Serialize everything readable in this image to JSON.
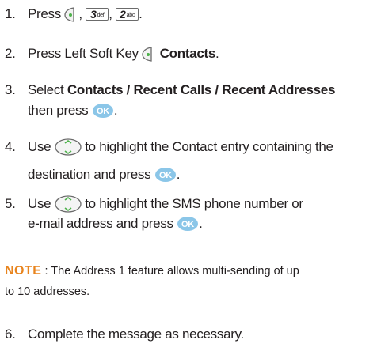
{
  "steps": [
    {
      "num": "1.",
      "press": "Press",
      "key3_digit": "3",
      "key3_letters": "def",
      "key2_digit": "2",
      "key2_letters": "abc"
    },
    {
      "num": "2.",
      "text": "Press Left Soft Key",
      "bold": "Contacts"
    },
    {
      "num": "3.",
      "pre": "Select",
      "bold": "Contacts / Recent Calls / Recent Addresses",
      "line2": "then press"
    },
    {
      "num": "4.",
      "pre": "Use",
      "rest": "to highlight the Contact entry containing the",
      "line2": "destination and press"
    },
    {
      "num": "5.",
      "pre": "Use",
      "rest": "to highlight the SMS phone number or",
      "line2": "e-mail address and press"
    },
    {
      "num": "6.",
      "text": "Complete the message as necessary."
    }
  ],
  "note": {
    "label": "NOTE",
    "text": ": The Address 1 feature allows multi-sending of up",
    "line2": "to 10 addresses."
  },
  "icons": {
    "soft_key": "left-soft-key-icon",
    "ok": "ok-button-icon",
    "nav": "navigation-key-icon",
    "ok_label": "OK",
    "ok_color": "#8bc6e8"
  }
}
